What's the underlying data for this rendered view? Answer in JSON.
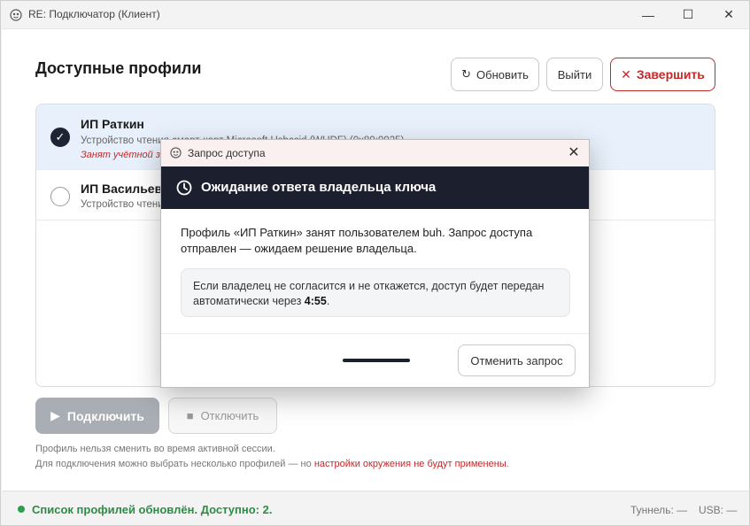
{
  "window": {
    "title": "RE: Подключатор (Клиент)",
    "controls": {
      "minimize": "—",
      "maximize": "☐",
      "close": "✕"
    }
  },
  "header": {
    "title": "Доступные профили",
    "refresh_label": "Обновить",
    "refresh_icon": "↻",
    "logout_label": "Выйти",
    "finish_label": "Завершить",
    "finish_icon": "✕"
  },
  "profiles": [
    {
      "name": "ИП Раткин",
      "device": "Устройство чтения смарт-карт Microsoft Usbccid (WUDF) (0x80:0025)",
      "busy_note": "Занят учётной записью buh",
      "selected": true
    },
    {
      "name": "ИП Васильев",
      "device": "Устройство чтения смарт-карт",
      "selected": false
    }
  ],
  "actions": {
    "connect_label": "Подключить",
    "connect_icon": "▶",
    "disconnect_label": "Отключить",
    "disconnect_icon": "■"
  },
  "notes": {
    "line1": "Профиль нельзя сменить во время активной сессии.",
    "line2_prefix": "Для подключения можно выбрать несколько профилей — но ",
    "line2_red": "настройки окружения не будут применены",
    "line2_suffix": "."
  },
  "status": {
    "text": "Список профилей обновлён. Доступно: 2.",
    "tunnel": "Туннель: —",
    "usb": "USB: —"
  },
  "dialog": {
    "title": "Запрос доступа",
    "close": "✕",
    "heading": "Ожидание ответа владельца ключа",
    "body": "Профиль «ИП Раткин» занят пользователем buh. Запрос доступа отправлен — ожидаем решение владельца.",
    "info_prefix": "Если владелец не согласится и не откажется, доступ будет передан автоматически через ",
    "countdown": "4:55",
    "info_suffix": ".",
    "cancel_label": "Отменить запрос"
  },
  "colors": {
    "accent_dark": "#1c1f2e",
    "danger": "#c62828",
    "success": "#2e8b46",
    "selected_row": "#e8f1fb"
  }
}
